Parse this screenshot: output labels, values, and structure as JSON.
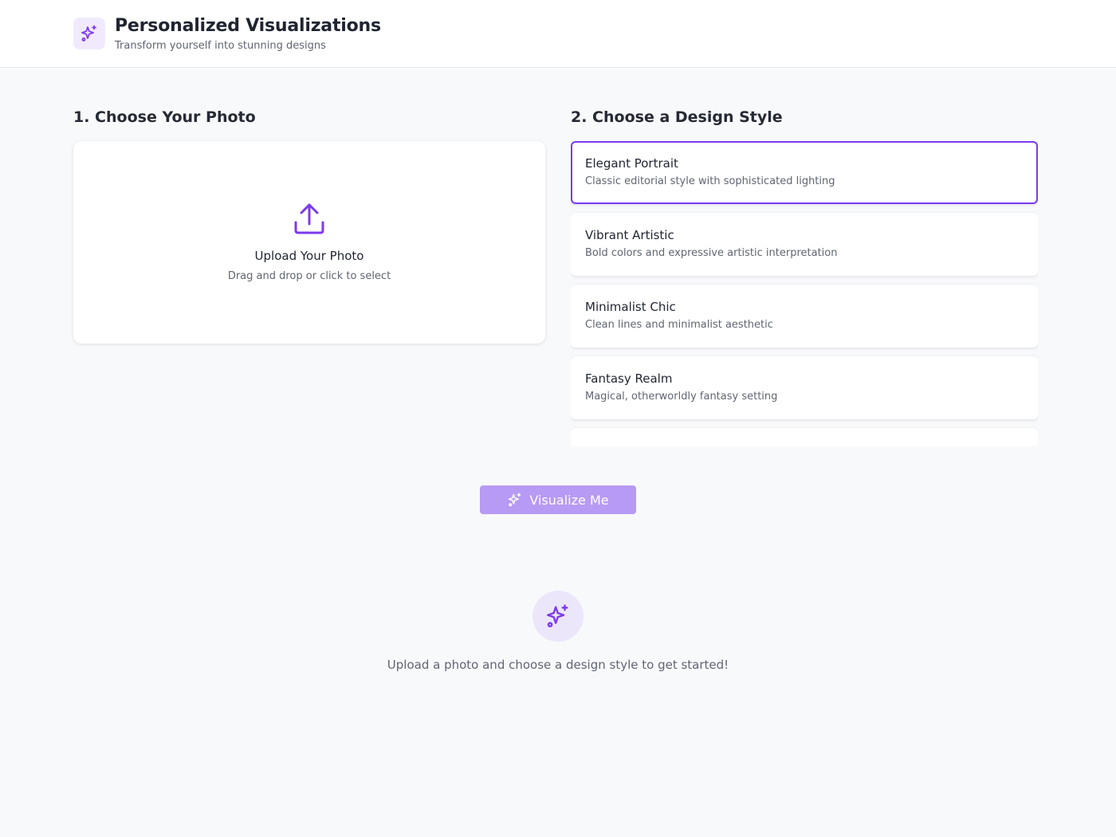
{
  "header": {
    "title": "Personalized Visualizations",
    "subtitle": "Transform yourself into stunning designs",
    "logo_icon": "sparkles-icon"
  },
  "photo_section": {
    "title": "1. Choose Your Photo",
    "upload_icon": "upload-icon",
    "upload_title": "Upload Your Photo",
    "upload_hint": "Drag and drop or click to select"
  },
  "style_section": {
    "title": "2. Choose a Design Style",
    "selected_index": 0,
    "styles": [
      {
        "name": "Elegant Portrait",
        "description": "Classic editorial style with sophisticated lighting"
      },
      {
        "name": "Vibrant Artistic",
        "description": "Bold colors and expressive artistic interpretation"
      },
      {
        "name": "Minimalist Chic",
        "description": "Clean lines and minimalist aesthetic"
      },
      {
        "name": "Fantasy Realm",
        "description": "Magical, otherworldly fantasy setting"
      }
    ]
  },
  "actions": {
    "visualize_label": "Visualize Me",
    "visualize_icon": "sparkles-icon"
  },
  "empty_state": {
    "icon": "sparkles-icon",
    "message": "Upload a photo and choose a design style to get started!"
  },
  "colors": {
    "accent": "#7c3aed",
    "button_disabled": "#b79af3",
    "background": "#f8f9fb"
  }
}
